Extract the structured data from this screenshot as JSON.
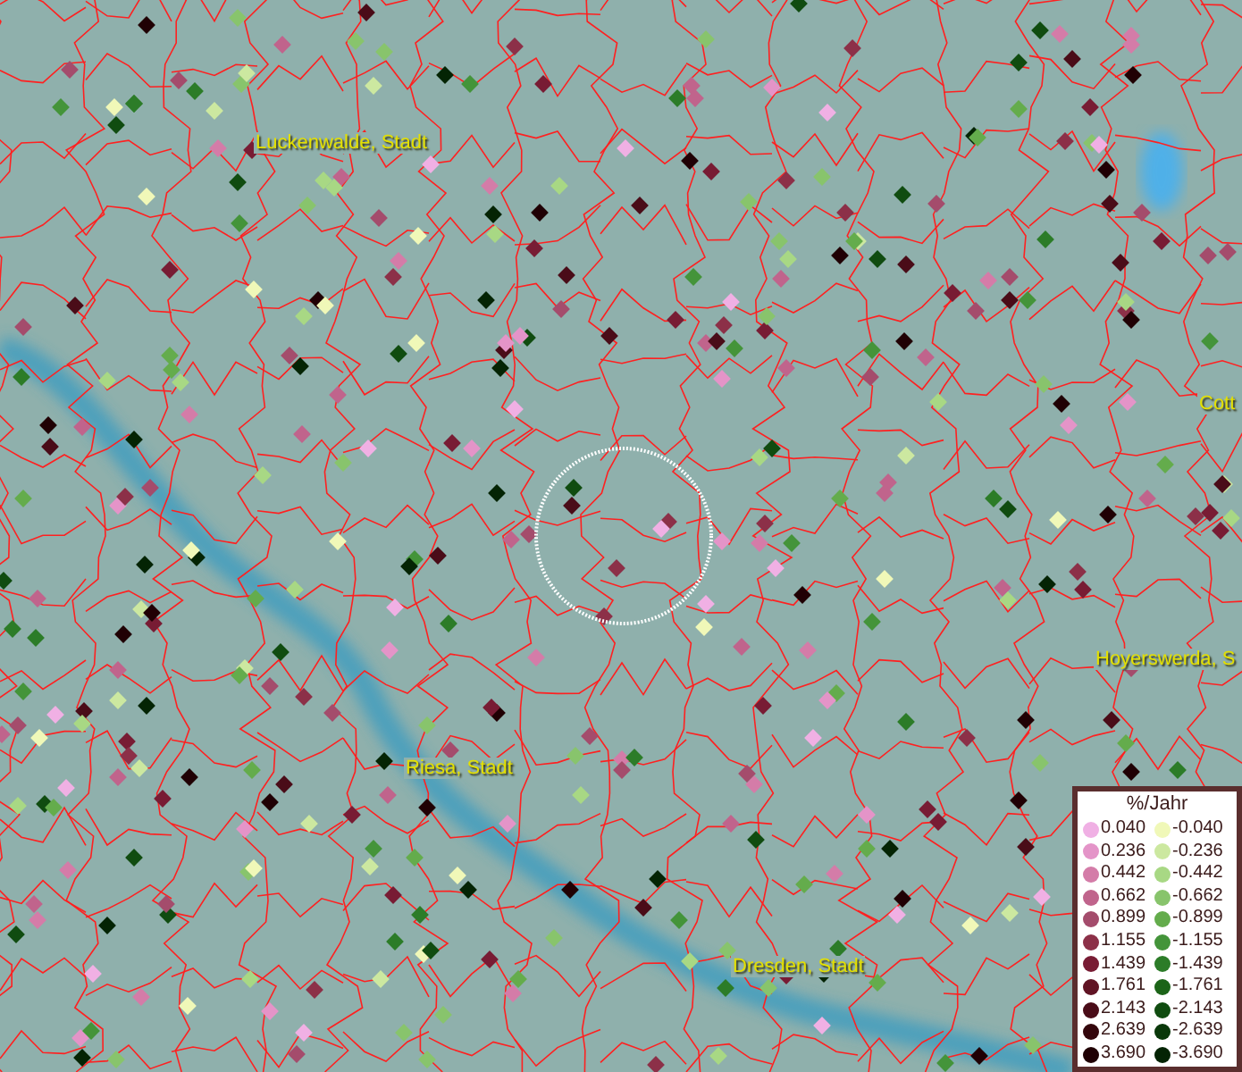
{
  "map": {
    "place_labels": [
      {
        "text": "Luckenwalde, Stadt"
      },
      {
        "text": "Cott"
      },
      {
        "text": "Hoyerswerda, S"
      },
      {
        "text": "Riesa, Stadt"
      },
      {
        "text": "Dresden, Stadt"
      }
    ]
  },
  "legend": {
    "title": "%/Jahr",
    "rows": [
      {
        "positive": {
          "value": "0.040",
          "color": "#f0b0e4"
        },
        "negative": {
          "value": "-0.040",
          "color": "#f0f8b8"
        }
      },
      {
        "positive": {
          "value": "0.236",
          "color": "#e494c8"
        },
        "negative": {
          "value": "-0.236",
          "color": "#cce8a0"
        }
      },
      {
        "positive": {
          "value": "0.442",
          "color": "#d47ca8"
        },
        "negative": {
          "value": "-0.442",
          "color": "#a8d884"
        }
      },
      {
        "positive": {
          "value": "0.662",
          "color": "#c0648c"
        },
        "negative": {
          "value": "-0.662",
          "color": "#88c46c"
        }
      },
      {
        "positive": {
          "value": "0.899",
          "color": "#a44c6c"
        },
        "negative": {
          "value": "-0.899",
          "color": "#64ac4c"
        }
      },
      {
        "positive": {
          "value": "1.155",
          "color": "#8c3048"
        },
        "negative": {
          "value": "-1.155",
          "color": "#44943a"
        }
      },
      {
        "positive": {
          "value": "1.439",
          "color": "#781c34"
        },
        "negative": {
          "value": "-1.439",
          "color": "#2c7c28"
        }
      },
      {
        "positive": {
          "value": "1.761",
          "color": "#601424"
        },
        "negative": {
          "value": "-1.761",
          "color": "#1c6418"
        }
      },
      {
        "positive": {
          "value": "2.143",
          "color": "#4a0c18"
        },
        "negative": {
          "value": "-2.143",
          "color": "#104c10"
        }
      },
      {
        "positive": {
          "value": "2.639",
          "color": "#34060c"
        },
        "negative": {
          "value": "-2.639",
          "color": "#0a380a"
        }
      },
      {
        "positive": {
          "value": "3.690",
          "color": "#200004"
        },
        "negative": {
          "value": "-3.690",
          "color": "#042404"
        }
      }
    ]
  }
}
